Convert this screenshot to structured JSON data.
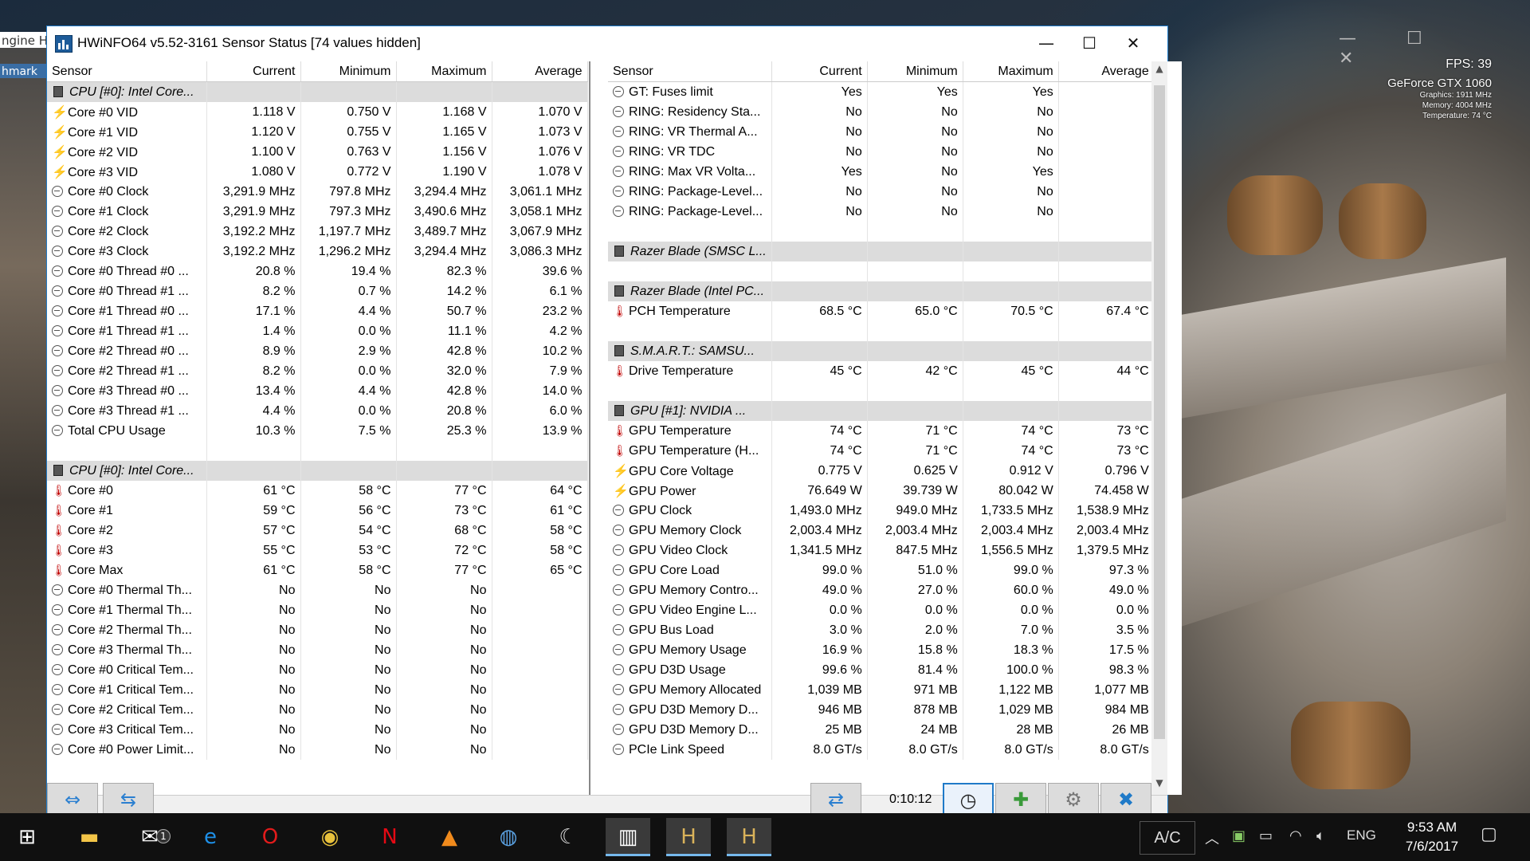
{
  "window": {
    "title": "HWiNFO64 v5.52-3161 Sensor Status [74 values hidden]",
    "min_label": "—",
    "max_label": "☐",
    "close_label": "✕"
  },
  "background": {
    "left_label_top": "ngine H",
    "left_label_bottom": "hmark"
  },
  "osd": {
    "fps": "FPS: 39",
    "gpu": "GeForce GTX 1060",
    "graphics": "Graphics: 1911 MHz",
    "memory": "Memory: 4004 MHz",
    "temperature": "Temperature: 74 °C"
  },
  "columns": [
    "Sensor",
    "Current",
    "Minimum",
    "Maximum",
    "Average"
  ],
  "left_rows": [
    {
      "type": "group",
      "name": "CPU [#0]: Intel Core..."
    },
    {
      "icon": "bolt",
      "name": "Core #0 VID",
      "cur": "1.118 V",
      "min": "0.750 V",
      "max": "1.168 V",
      "avg": "1.070 V"
    },
    {
      "icon": "bolt",
      "name": "Core #1 VID",
      "cur": "1.120 V",
      "min": "0.755 V",
      "max": "1.165 V",
      "avg": "1.073 V"
    },
    {
      "icon": "bolt",
      "name": "Core #2 VID",
      "cur": "1.100 V",
      "min": "0.763 V",
      "max": "1.156 V",
      "avg": "1.076 V"
    },
    {
      "icon": "bolt",
      "name": "Core #3 VID",
      "cur": "1.080 V",
      "min": "0.772 V",
      "max": "1.190 V",
      "avg": "1.078 V"
    },
    {
      "icon": "clock",
      "name": "Core #0 Clock",
      "cur": "3,291.9 MHz",
      "min": "797.8 MHz",
      "max": "3,294.4 MHz",
      "avg": "3,061.1 MHz"
    },
    {
      "icon": "clock",
      "name": "Core #1 Clock",
      "cur": "3,291.9 MHz",
      "min": "797.3 MHz",
      "max": "3,490.6 MHz",
      "avg": "3,058.1 MHz"
    },
    {
      "icon": "clock",
      "name": "Core #2 Clock",
      "cur": "3,192.2 MHz",
      "min": "1,197.7 MHz",
      "max": "3,489.7 MHz",
      "avg": "3,067.9 MHz"
    },
    {
      "icon": "clock",
      "name": "Core #3 Clock",
      "cur": "3,192.2 MHz",
      "min": "1,296.2 MHz",
      "max": "3,294.4 MHz",
      "avg": "3,086.3 MHz"
    },
    {
      "icon": "clock",
      "name": "Core #0 Thread #0 ...",
      "cur": "20.8 %",
      "min": "19.4 %",
      "max": "82.3 %",
      "avg": "39.6 %"
    },
    {
      "icon": "clock",
      "name": "Core #0 Thread #1 ...",
      "cur": "8.2 %",
      "min": "0.7 %",
      "max": "14.2 %",
      "avg": "6.1 %"
    },
    {
      "icon": "clock",
      "name": "Core #1 Thread #0 ...",
      "cur": "17.1 %",
      "min": "4.4 %",
      "max": "50.7 %",
      "avg": "23.2 %"
    },
    {
      "icon": "clock",
      "name": "Core #1 Thread #1 ...",
      "cur": "1.4 %",
      "min": "0.0 %",
      "max": "11.1 %",
      "avg": "4.2 %"
    },
    {
      "icon": "clock",
      "name": "Core #2 Thread #0 ...",
      "cur": "8.9 %",
      "min": "2.9 %",
      "max": "42.8 %",
      "avg": "10.2 %"
    },
    {
      "icon": "clock",
      "name": "Core #2 Thread #1 ...",
      "cur": "8.2 %",
      "min": "0.0 %",
      "max": "32.0 %",
      "avg": "7.9 %"
    },
    {
      "icon": "clock",
      "name": "Core #3 Thread #0 ...",
      "cur": "13.4 %",
      "min": "4.4 %",
      "max": "42.8 %",
      "avg": "14.0 %"
    },
    {
      "icon": "clock",
      "name": "Core #3 Thread #1 ...",
      "cur": "4.4 %",
      "min": "0.0 %",
      "max": "20.8 %",
      "avg": "6.0 %"
    },
    {
      "icon": "clock",
      "name": "Total CPU Usage",
      "cur": "10.3 %",
      "min": "7.5 %",
      "max": "25.3 %",
      "avg": "13.9 %"
    },
    {
      "type": "empty"
    },
    {
      "type": "group",
      "name": "CPU [#0]: Intel Core..."
    },
    {
      "icon": "therm",
      "name": "Core #0",
      "cur": "61 °C",
      "min": "58 °C",
      "max": "77 °C",
      "avg": "64 °C"
    },
    {
      "icon": "therm",
      "name": "Core #1",
      "cur": "59 °C",
      "min": "56 °C",
      "max": "73 °C",
      "avg": "61 °C"
    },
    {
      "icon": "therm",
      "name": "Core #2",
      "cur": "57 °C",
      "min": "54 °C",
      "max": "68 °C",
      "avg": "58 °C"
    },
    {
      "icon": "therm",
      "name": "Core #3",
      "cur": "55 °C",
      "min": "53 °C",
      "max": "72 °C",
      "avg": "58 °C"
    },
    {
      "icon": "therm",
      "name": "Core Max",
      "cur": "61 °C",
      "min": "58 °C",
      "max": "77 °C",
      "avg": "65 °C"
    },
    {
      "icon": "clock",
      "name": "Core #0 Thermal Th...",
      "cur": "No",
      "min": "No",
      "max": "No",
      "avg": ""
    },
    {
      "icon": "clock",
      "name": "Core #1 Thermal Th...",
      "cur": "No",
      "min": "No",
      "max": "No",
      "avg": ""
    },
    {
      "icon": "clock",
      "name": "Core #2 Thermal Th...",
      "cur": "No",
      "min": "No",
      "max": "No",
      "avg": ""
    },
    {
      "icon": "clock",
      "name": "Core #3 Thermal Th...",
      "cur": "No",
      "min": "No",
      "max": "No",
      "avg": ""
    },
    {
      "icon": "clock",
      "name": "Core #0 Critical Tem...",
      "cur": "No",
      "min": "No",
      "max": "No",
      "avg": ""
    },
    {
      "icon": "clock",
      "name": "Core #1 Critical Tem...",
      "cur": "No",
      "min": "No",
      "max": "No",
      "avg": ""
    },
    {
      "icon": "clock",
      "name": "Core #2 Critical Tem...",
      "cur": "No",
      "min": "No",
      "max": "No",
      "avg": ""
    },
    {
      "icon": "clock",
      "name": "Core #3 Critical Tem...",
      "cur": "No",
      "min": "No",
      "max": "No",
      "avg": ""
    },
    {
      "icon": "clock",
      "name": "Core #0 Power Limit...",
      "cur": "No",
      "min": "No",
      "max": "No",
      "avg": ""
    }
  ],
  "right_rows": [
    {
      "icon": "clock",
      "name": "GT: Fuses limit",
      "cur": "Yes",
      "min": "Yes",
      "max": "Yes",
      "avg": ""
    },
    {
      "icon": "clock",
      "name": "RING: Residency Sta...",
      "cur": "No",
      "min": "No",
      "max": "No",
      "avg": ""
    },
    {
      "icon": "clock",
      "name": "RING: VR Thermal A...",
      "cur": "No",
      "min": "No",
      "max": "No",
      "avg": ""
    },
    {
      "icon": "clock",
      "name": "RING: VR TDC",
      "cur": "No",
      "min": "No",
      "max": "No",
      "avg": ""
    },
    {
      "icon": "clock",
      "name": "RING: Max VR Volta...",
      "cur": "Yes",
      "min": "No",
      "max": "Yes",
      "avg": ""
    },
    {
      "icon": "clock",
      "name": "RING: Package-Level...",
      "cur": "No",
      "min": "No",
      "max": "No",
      "avg": ""
    },
    {
      "icon": "clock",
      "name": "RING: Package-Level...",
      "cur": "No",
      "min": "No",
      "max": "No",
      "avg": ""
    },
    {
      "type": "empty"
    },
    {
      "type": "group",
      "name": "Razer Blade (SMSC L..."
    },
    {
      "type": "empty"
    },
    {
      "type": "group",
      "name": "Razer Blade (Intel PC..."
    },
    {
      "icon": "therm",
      "name": "PCH Temperature",
      "cur": "68.5 °C",
      "min": "65.0 °C",
      "max": "70.5 °C",
      "avg": "67.4 °C"
    },
    {
      "type": "empty"
    },
    {
      "type": "group",
      "name": "S.M.A.R.T.: SAMSU..."
    },
    {
      "icon": "therm",
      "name": "Drive Temperature",
      "cur": "45 °C",
      "min": "42 °C",
      "max": "45 °C",
      "avg": "44 °C"
    },
    {
      "type": "empty"
    },
    {
      "type": "group",
      "name": "GPU [#1]: NVIDIA ..."
    },
    {
      "icon": "therm",
      "name": "GPU Temperature",
      "cur": "74 °C",
      "min": "71 °C",
      "max": "74 °C",
      "avg": "73 °C"
    },
    {
      "icon": "therm",
      "name": "GPU Temperature (H...",
      "cur": "74 °C",
      "min": "71 °C",
      "max": "74 °C",
      "avg": "73 °C"
    },
    {
      "icon": "bolt",
      "name": "GPU Core Voltage",
      "cur": "0.775 V",
      "min": "0.625 V",
      "max": "0.912 V",
      "avg": "0.796 V"
    },
    {
      "icon": "bolt",
      "name": "GPU Power",
      "cur": "76.649 W",
      "min": "39.739 W",
      "max": "80.042 W",
      "avg": "74.458 W"
    },
    {
      "icon": "clock",
      "name": "GPU Clock",
      "cur": "1,493.0 MHz",
      "min": "949.0 MHz",
      "max": "1,733.5 MHz",
      "avg": "1,538.9 MHz"
    },
    {
      "icon": "clock",
      "name": "GPU Memory Clock",
      "cur": "2,003.4 MHz",
      "min": "2,003.4 MHz",
      "max": "2,003.4 MHz",
      "avg": "2,003.4 MHz"
    },
    {
      "icon": "clock",
      "name": "GPU Video Clock",
      "cur": "1,341.5 MHz",
      "min": "847.5 MHz",
      "max": "1,556.5 MHz",
      "avg": "1,379.5 MHz"
    },
    {
      "icon": "clock",
      "name": "GPU Core Load",
      "cur": "99.0 %",
      "min": "51.0 %",
      "max": "99.0 %",
      "avg": "97.3 %"
    },
    {
      "icon": "clock",
      "name": "GPU Memory Contro...",
      "cur": "49.0 %",
      "min": "27.0 %",
      "max": "60.0 %",
      "avg": "49.0 %"
    },
    {
      "icon": "clock",
      "name": "GPU Video Engine L...",
      "cur": "0.0 %",
      "min": "0.0 %",
      "max": "0.0 %",
      "avg": "0.0 %"
    },
    {
      "icon": "clock",
      "name": "GPU Bus Load",
      "cur": "3.0 %",
      "min": "2.0 %",
      "max": "7.0 %",
      "avg": "3.5 %"
    },
    {
      "icon": "clock",
      "name": "GPU Memory Usage",
      "cur": "16.9 %",
      "min": "15.8 %",
      "max": "18.3 %",
      "avg": "17.5 %"
    },
    {
      "icon": "clock",
      "name": "GPU D3D Usage",
      "cur": "99.6 %",
      "min": "81.4 %",
      "max": "100.0 %",
      "avg": "98.3 %"
    },
    {
      "icon": "clock",
      "name": "GPU Memory Allocated",
      "cur": "1,039 MB",
      "min": "971 MB",
      "max": "1,122 MB",
      "avg": "1,077 MB"
    },
    {
      "icon": "clock",
      "name": "GPU D3D Memory D...",
      "cur": "946 MB",
      "min": "878 MB",
      "max": "1,029 MB",
      "avg": "984 MB"
    },
    {
      "icon": "clock",
      "name": "GPU D3D Memory D...",
      "cur": "25 MB",
      "min": "24 MB",
      "max": "28 MB",
      "avg": "26 MB"
    },
    {
      "icon": "clock",
      "name": "PCIe Link Speed",
      "cur": "8.0 GT/s",
      "min": "8.0 GT/s",
      "max": "8.0 GT/s",
      "avg": "8.0 GT/s"
    }
  ],
  "toolbar": {
    "expand_label": "⇔",
    "collapse_label": "⇆",
    "network_label": "⇄",
    "timer": "0:10:12",
    "clock_label": "◷",
    "log_label": "✚",
    "settings_label": "⚙",
    "close_label": "✖"
  },
  "taskbar": {
    "ac_label": "A/C",
    "language": "ENG",
    "time": "9:53 AM",
    "date": "7/6/2017",
    "mail_badge": "1"
  }
}
